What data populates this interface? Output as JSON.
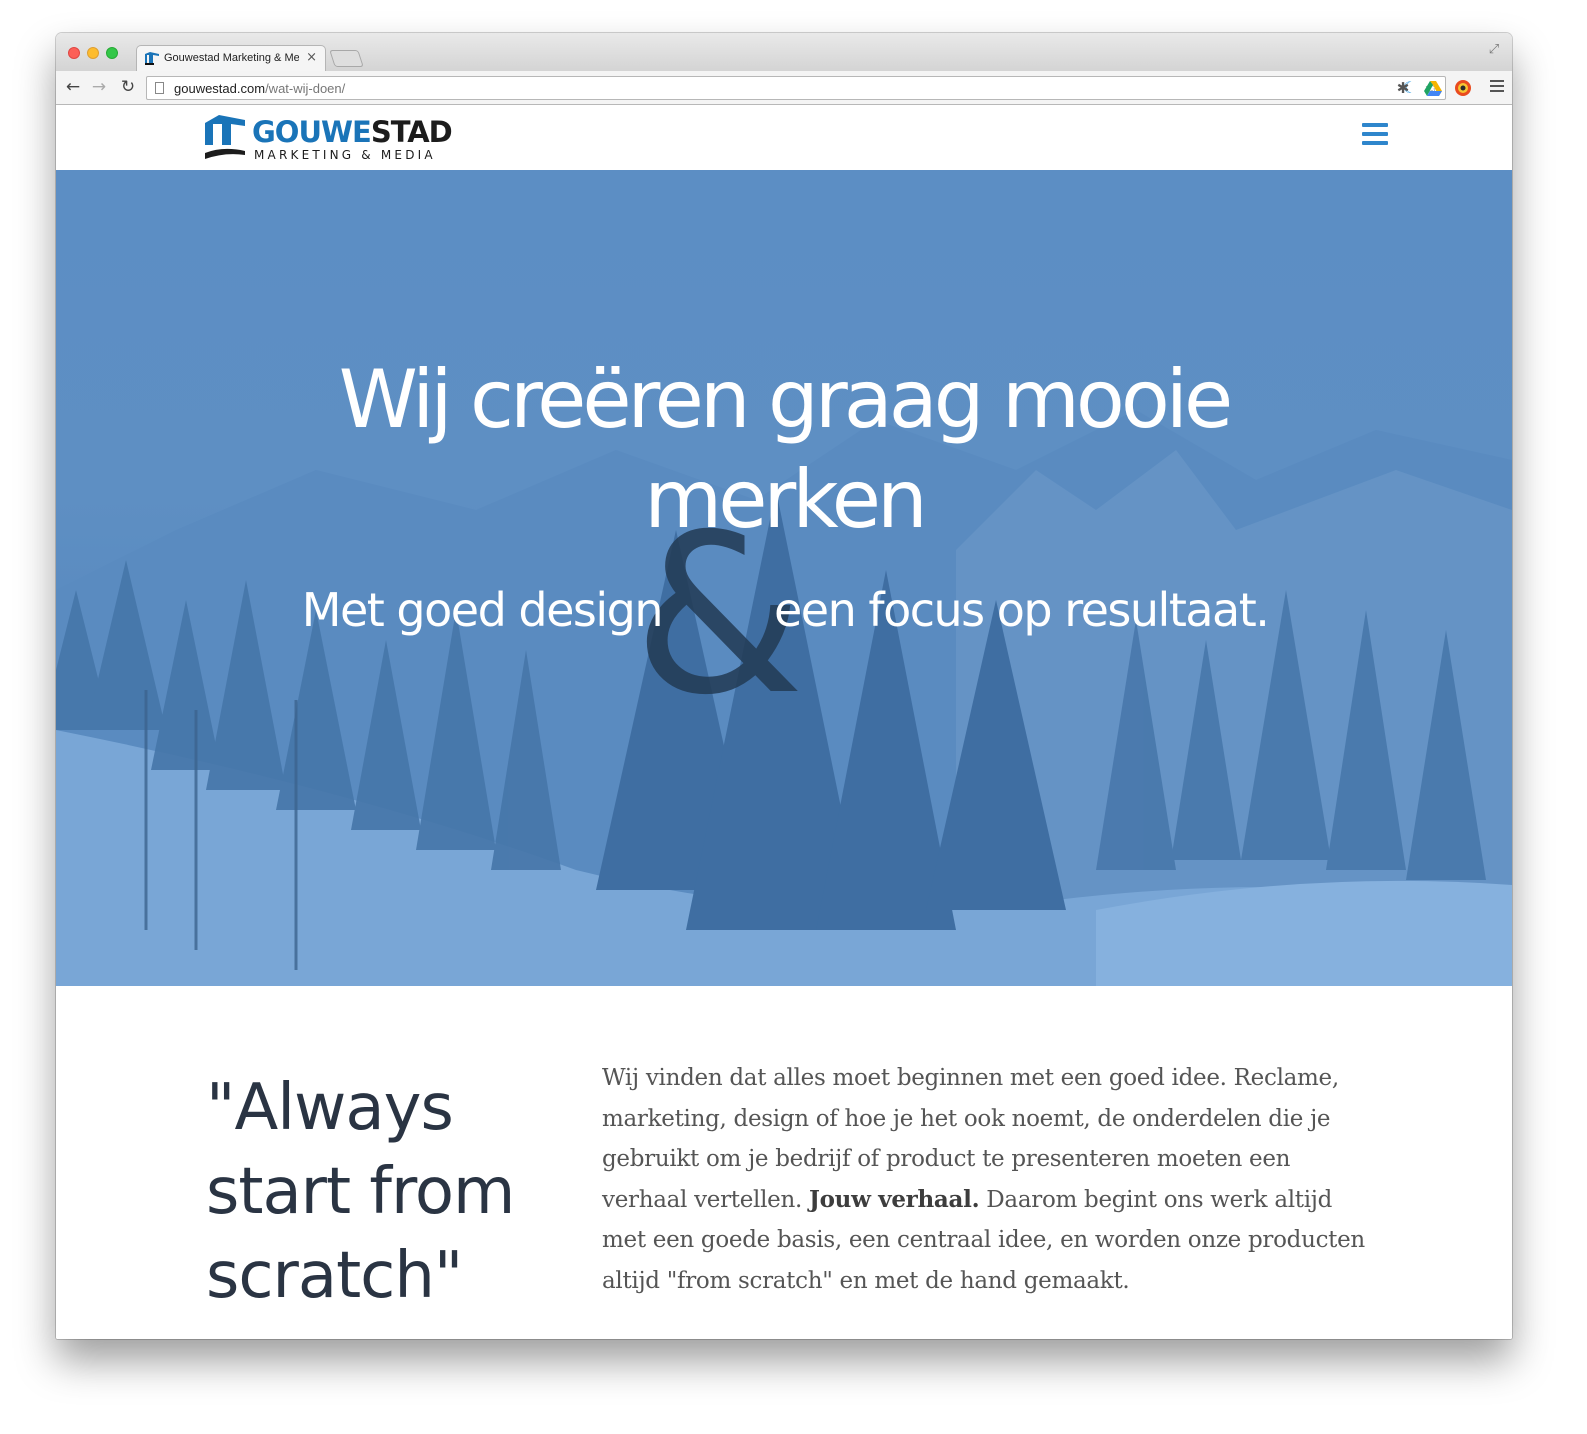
{
  "browser": {
    "tab_title": "Gouwestad Marketing & Media",
    "tab_close": "×",
    "url_host": "gouwestad.com",
    "url_path": "/wat-wij-doen/"
  },
  "header": {
    "logo_name_blue": "GOUWE",
    "logo_name_dark": "STAD",
    "logo_tagline": "MARKETING & MEDIA",
    "menu_icon": "hamburger-icon"
  },
  "hero": {
    "title": "Wij creëren graag mooie merken",
    "ampersand": "&",
    "subtitle_left": "Met goed design",
    "subtitle_right": "een focus op resultaat."
  },
  "intro": {
    "quote": "\"Always start from scratch\"",
    "body_before": "Wij vinden dat alles moet beginnen met een goed idee. Reclame, marketing, design of hoe je het ook noemt, de onderdelen die je gebruikt om je bedrijf of product te presenteren moeten een verhaal vertellen. ",
    "body_bold": "Jouw verhaal.",
    "body_after": " Daarom begint ons werk altijd met een goede basis, een centraal idee, en worden onze producten altijd \"from scratch\" en met de hand gemaakt."
  },
  "colors": {
    "brand_blue": "#1a74b8",
    "hero_overlay": "#5b8dc3",
    "heading_dark": "#2a3443"
  }
}
